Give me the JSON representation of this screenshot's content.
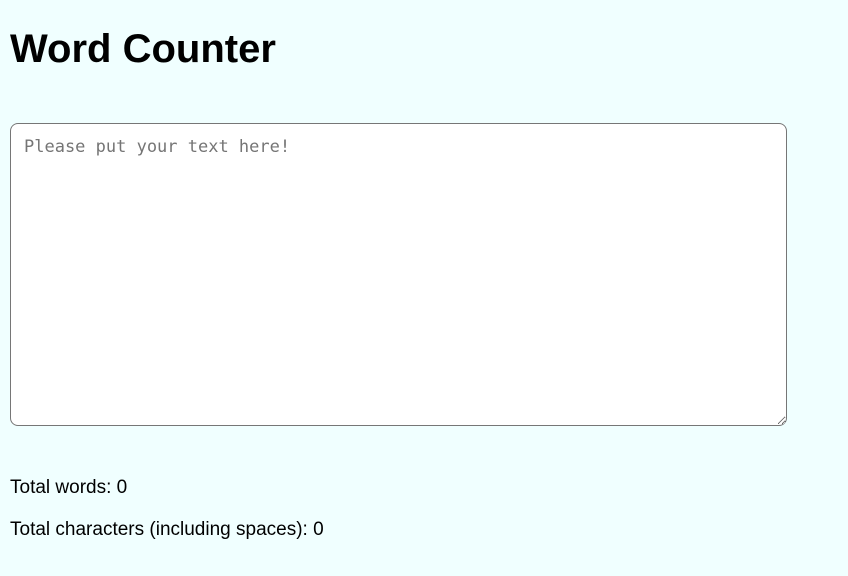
{
  "header": {
    "title": "Word Counter"
  },
  "editor": {
    "placeholder": "Please put your text here!",
    "value": ""
  },
  "stats": {
    "words_label": "Total words:",
    "words_value": "0",
    "chars_label": "Total characters (including spaces):",
    "chars_value": "0"
  },
  "colors": {
    "background": "#f0ffff",
    "textarea_border": "#767676"
  }
}
